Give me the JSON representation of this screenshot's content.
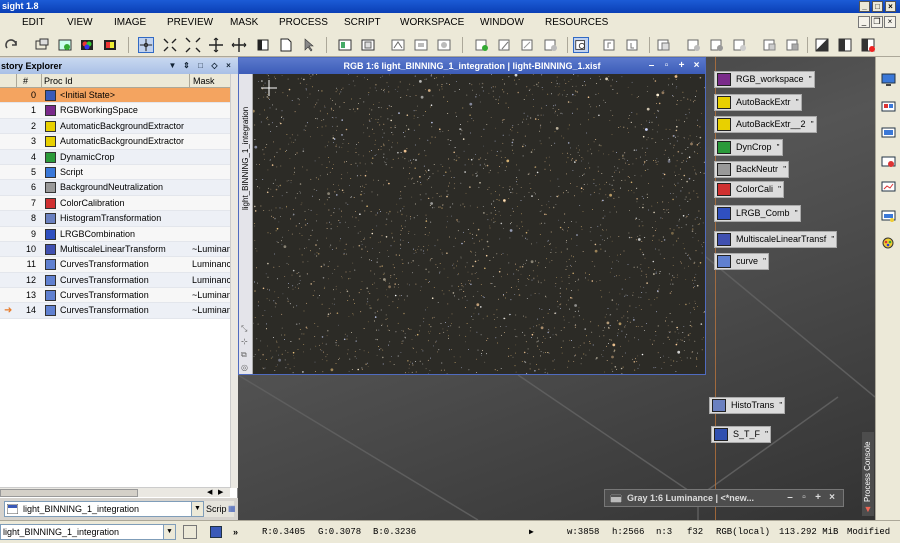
{
  "window": {
    "title": "sight 1.8"
  },
  "menu": {
    "items": [
      "EDIT",
      "VIEW",
      "IMAGE",
      "PREVIEW",
      "MASK",
      "PROCESS",
      "SCRIPT",
      "WORKSPACE",
      "WINDOW",
      "RESOURCES"
    ]
  },
  "history": {
    "title": "story Explorer",
    "columns": {
      "num": "#",
      "proc": "Proc Id",
      "mask": "Mask"
    },
    "rows": [
      {
        "num": "0",
        "name": "<Initial State>",
        "mask": ""
      },
      {
        "num": "1",
        "name": "RGBWorkingSpace",
        "mask": ""
      },
      {
        "num": "2",
        "name": "AutomaticBackgroundExtractor",
        "mask": ""
      },
      {
        "num": "3",
        "name": "AutomaticBackgroundExtractor",
        "mask": ""
      },
      {
        "num": "4",
        "name": "DynamicCrop",
        "mask": ""
      },
      {
        "num": "5",
        "name": "Script",
        "mask": ""
      },
      {
        "num": "6",
        "name": "BackgroundNeutralization",
        "mask": ""
      },
      {
        "num": "7",
        "name": "ColorCalibration",
        "mask": ""
      },
      {
        "num": "8",
        "name": "HistogramTransformation",
        "mask": ""
      },
      {
        "num": "9",
        "name": "LRGBCombination",
        "mask": ""
      },
      {
        "num": "10",
        "name": "MultiscaleLinearTransform",
        "mask": "~Luminanc"
      },
      {
        "num": "11",
        "name": "CurvesTransformation",
        "mask": "Luminanc"
      },
      {
        "num": "12",
        "name": "CurvesTransformation",
        "mask": "Luminanc"
      },
      {
        "num": "13",
        "name": "CurvesTransformation",
        "mask": "~Luminanc"
      },
      {
        "num": "14",
        "name": "CurvesTransformation",
        "mask": "~Luminanc"
      }
    ],
    "view_selector": "light_BINNING_1_integration",
    "script_tab": "Scrip"
  },
  "image_window": {
    "title": "RGB 1:6 light_BINNING_1_integration | light-BINNING_1.xisf",
    "side_label": "light_BINNING_1_integration"
  },
  "process_icons": [
    {
      "label": "RGB_workspace",
      "icon": "rgb-workspace-icon",
      "color": "#7a2a8a"
    },
    {
      "label": "AutoBackExtr",
      "icon": "abe-icon",
      "color": "#e8d000"
    },
    {
      "label": "AutoBackExtr__2",
      "icon": "abe-icon",
      "color": "#e8d000"
    },
    {
      "label": "DynCrop",
      "icon": "crop-icon",
      "color": "#2a9a3a"
    },
    {
      "label": "BackNeutr",
      "icon": "backneutr-icon",
      "color": "#999999"
    },
    {
      "label": "ColorCali",
      "icon": "colorcal-icon",
      "color": "#d03030"
    },
    {
      "label": "LRGB_Comb",
      "icon": "lrgb-icon",
      "color": "#3050c0"
    },
    {
      "label": "MultiscaleLinearTransf",
      "icon": "mlt-icon",
      "color": "#4050b0"
    },
    {
      "label": "curve",
      "icon": "curve-icon",
      "color": "#6080d0"
    },
    {
      "label": "HistoTrans",
      "icon": "histo-icon",
      "color": "#6a80c0"
    },
    {
      "label": "S_T_F",
      "icon": "stf-icon",
      "color": "#3050b0"
    }
  ],
  "gray_window": {
    "title": "Gray 1:6 Luminance | <*new..."
  },
  "process_console": "Process Console",
  "status": {
    "view": "light_BINNING_1_integration",
    "r": "R:0.3405",
    "g": "G:0.3078",
    "b": "B:0.3236",
    "w": "w:3858",
    "h": "h:2566",
    "n": "n:3",
    "bits": "f32",
    "colorspace": "RGB(local)",
    "size": "113.292 MiB",
    "modified": "Modified"
  }
}
